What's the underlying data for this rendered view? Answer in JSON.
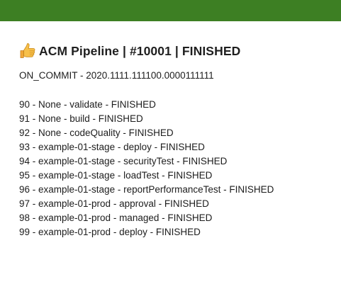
{
  "colors": {
    "top_bar": "#3d7f23",
    "background": "#ffffff",
    "text": "#1d1d1d"
  },
  "header": {
    "icon": "thumbs-up-icon",
    "title": "ACM Pipeline | #10001 | FINISHED"
  },
  "trigger": {
    "text": "ON_COMMIT - 2020.1111.111100.0000111111"
  },
  "steps": [
    "90 - None - validate - FINISHED",
    "91 - None - build - FINISHED",
    "92 - None - codeQuality - FINISHED",
    "93 - example-01-stage - deploy - FINISHED",
    "94 - example-01-stage - securityTest - FINISHED",
    "95 - example-01-stage - loadTest - FINISHED",
    "96 - example-01-stage - reportPerformanceTest - FINISHED",
    "97 - example-01-prod - approval - FINISHED",
    "98 - example-01-prod - managed - FINISHED",
    "99 - example-01-prod - deploy - FINISHED"
  ]
}
